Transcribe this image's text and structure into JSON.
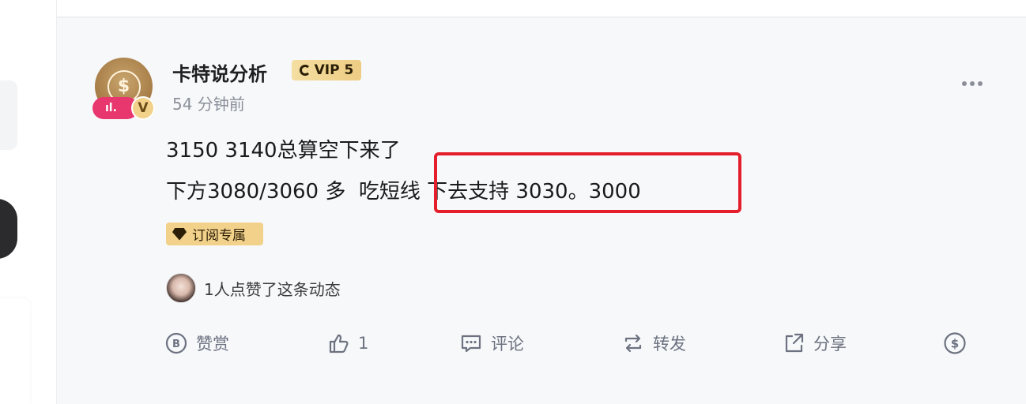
{
  "post": {
    "author": "卡特说分析",
    "vip_label": "VIP 5",
    "avatar_badge": "V",
    "time": "54 分钟前",
    "lines": [
      "3150 3140总算空下来了",
      "下方3080/3060 多  吃短线 下去支持 3030。3000"
    ],
    "tag": "订阅专属",
    "likes_text": "1人点赞了这条动态"
  },
  "actions": {
    "reward": "赞赏",
    "like_count": "1",
    "comment": "评论",
    "repost": "转发",
    "share": "分享"
  },
  "colors": {
    "highlight_border": "#e41e2a",
    "gold": "#f2d18a",
    "live_pink": "#e8376f"
  }
}
